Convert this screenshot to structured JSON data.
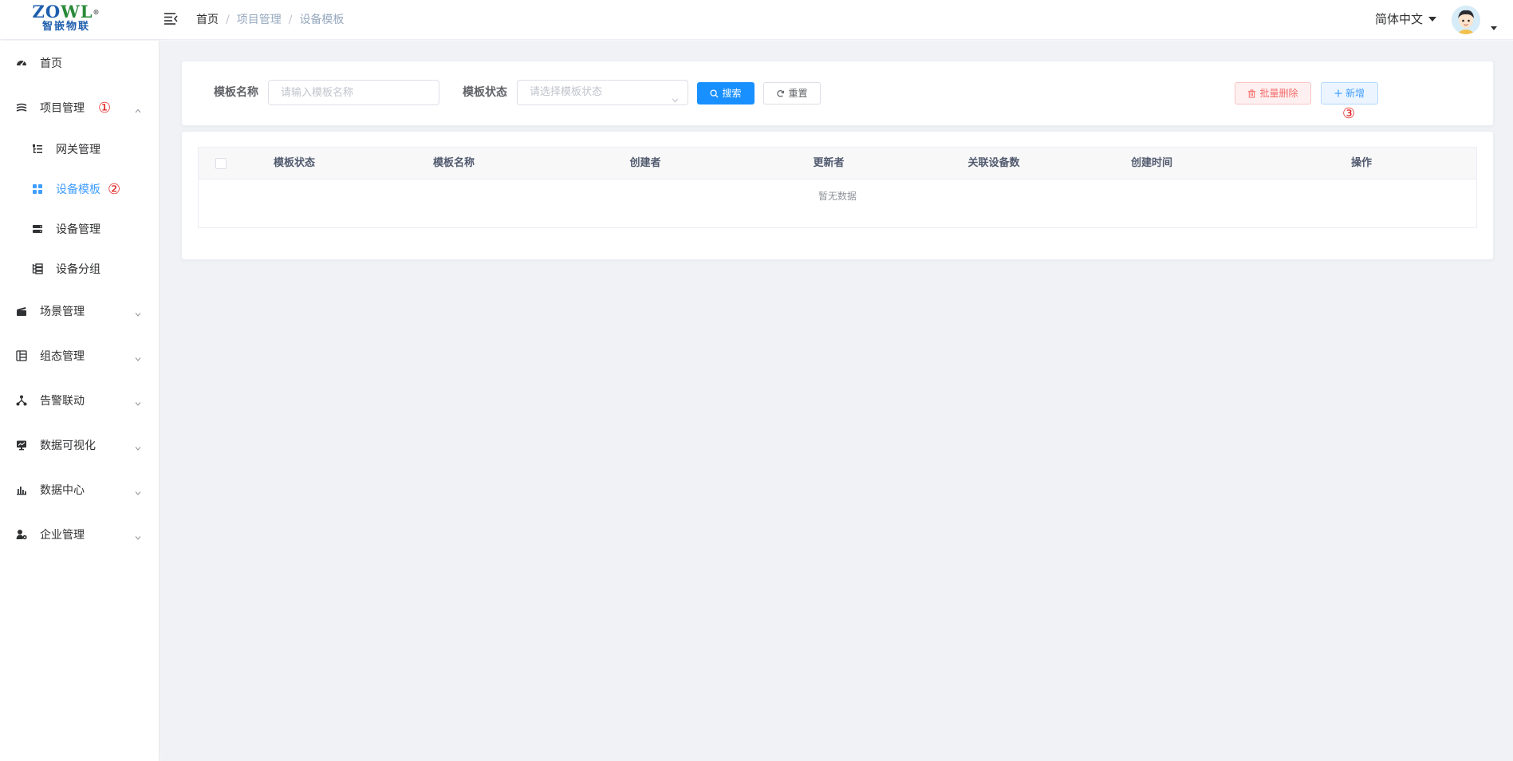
{
  "logo": {
    "line1_a": "ZO",
    "line1_b": "WL",
    "reg": "®",
    "line2": "智嵌物联"
  },
  "header": {
    "breadcrumb": [
      "首页",
      "项目管理",
      "设备模板"
    ],
    "breadcrumb_sep": "/",
    "language": "简体中文"
  },
  "sidebar": {
    "items": [
      {
        "label": "首页",
        "icon": "dashboard-icon"
      },
      {
        "label": "项目管理",
        "icon": "layers-icon",
        "expanded": true,
        "marker": "①",
        "children": [
          {
            "label": "网关管理",
            "icon": "tree-icon"
          },
          {
            "label": "设备模板",
            "icon": "grid-icon",
            "active": true,
            "marker": "②"
          },
          {
            "label": "设备管理",
            "icon": "server-icon"
          },
          {
            "label": "设备分组",
            "icon": "group-icon"
          }
        ]
      },
      {
        "label": "场景管理",
        "icon": "clapper-icon"
      },
      {
        "label": "组态管理",
        "icon": "list-icon"
      },
      {
        "label": "告警联动",
        "icon": "network-icon"
      },
      {
        "label": "数据可视化",
        "icon": "monitor-icon"
      },
      {
        "label": "数据中心",
        "icon": "chart-icon"
      },
      {
        "label": "企业管理",
        "icon": "user-gear-icon"
      }
    ]
  },
  "search": {
    "name_label": "模板名称",
    "name_placeholder": "请输入模板名称",
    "status_label": "模板状态",
    "status_placeholder": "请选择模板状态",
    "search_button": "搜索",
    "reset_button": "重置"
  },
  "actions": {
    "batch_delete": "批量删除",
    "add": "新增",
    "marker": "③"
  },
  "table": {
    "columns": [
      "模板状态",
      "模板名称",
      "创建者",
      "更新者",
      "关联设备数",
      "创建时间",
      "操作"
    ],
    "empty_text": "暂无数据"
  },
  "colors": {
    "primary": "#1890ff",
    "active_menu": "#409eff",
    "danger": "#f56c6c",
    "marker": "#e02020"
  }
}
